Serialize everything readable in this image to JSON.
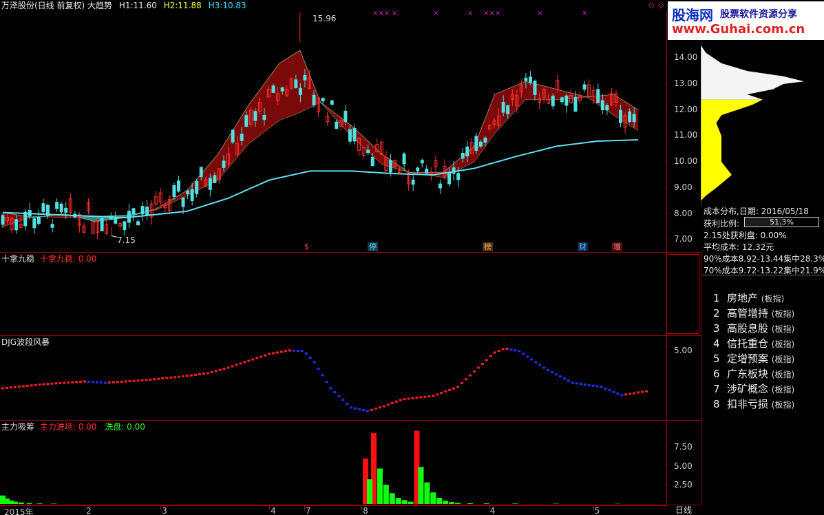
{
  "header": {
    "title": "万泽股份(日线 前复权) 大趋势",
    "h1_label": "H1:",
    "h1_value": "11.60",
    "h2_label": "H2:",
    "h2_value": "11.88",
    "h3_label": "H3:",
    "h3_value": "10.83",
    "diamond_left": "◇",
    "diamond_right": "◇"
  },
  "logo": {
    "brand": "股海网",
    "slogan": "股票软件资源分享",
    "url": "www.Guhai.com.cn"
  },
  "main_chart": {
    "price_high_label": "15.96",
    "price_low_label": "7.15",
    "y_ticks": [
      "14.00",
      "13.00",
      "12.00",
      "11.00",
      "10.00",
      "9.00",
      "8.00",
      "7.00"
    ],
    "event_labels": [
      {
        "text": "$",
        "color": "#ff4040"
      },
      {
        "text": "停",
        "color": "#60d0ff"
      },
      {
        "text": "榜",
        "color": "#ffb060"
      },
      {
        "text": "财",
        "color": "#60d0ff"
      },
      {
        "text": "增",
        "color": "#ff6060"
      }
    ],
    "markers": [
      "×××",
      "×",
      "×",
      "×",
      "×××",
      "×",
      "×"
    ]
  },
  "panel_2": {
    "name": "十拿九稳",
    "series_label": "十拿九稳:",
    "series_value": "0.00"
  },
  "panel_3": {
    "name": "DJG波段风暴",
    "y_ticks": [
      "5.00"
    ]
  },
  "panel_4": {
    "name": "主力吸筹",
    "series1_label": "主力进场:",
    "series1_value": "0.00",
    "series2_label": "洗盘:",
    "series2_value": "0.00",
    "y_ticks": [
      "7.50",
      "5.00",
      "2.50"
    ]
  },
  "x_axis": {
    "labels": [
      "2015年",
      "2",
      "3",
      "4",
      "7",
      "8",
      "4",
      "5"
    ],
    "period": "日线"
  },
  "cost_distribution": {
    "title": "成本分布,日期: 2016/05/18",
    "profit_ratio_label": "获利比例:",
    "profit_ratio_value": "51.3%",
    "profit_at_label": "2.15处获利盘: 0.00%",
    "avg_cost": "平均成本: 12.32元",
    "cost90": "90%成本8.92-13.44集中28.3%",
    "cost70": "70%成本9.72-13.22集中21.9%"
  },
  "sectors": [
    {
      "num": "1",
      "name": "房地产",
      "tag": "(板指)"
    },
    {
      "num": "2",
      "name": "高管增持",
      "tag": "(板指)"
    },
    {
      "num": "3",
      "name": "高股息股",
      "tag": "(板指)"
    },
    {
      "num": "4",
      "name": "信托重仓",
      "tag": "(板指)"
    },
    {
      "num": "5",
      "name": "定增预案",
      "tag": "(板指)"
    },
    {
      "num": "6",
      "name": "广东板块",
      "tag": "(板指)"
    },
    {
      "num": "7",
      "name": "涉矿概念",
      "tag": "(板指)"
    },
    {
      "num": "8",
      "name": "扣非亏损",
      "tag": "(板指)"
    }
  ],
  "chart_data": [
    {
      "type": "candlestick",
      "title": "万泽股份(日线 前复权) 大趋势",
      "ylim": [
        6.9,
        15.6
      ],
      "y_ticks": [
        14,
        13,
        12,
        11,
        10,
        9,
        8,
        7
      ],
      "x_labels": [
        "2015年",
        "2",
        "3",
        "4",
        "7",
        "8",
        "4",
        "5"
      ],
      "x_label_positions": [
        0,
        40,
        77,
        130,
        147,
        175,
        237,
        288
      ],
      "annotations": [
        {
          "text": "15.96",
          "x": 145,
          "y": 15.96
        },
        {
          "text": "7.15",
          "x": 53,
          "y": 7.15
        }
      ],
      "band_upper": [
        [
          0,
          8.05
        ],
        [
          15,
          7.85
        ],
        [
          30,
          8.0
        ],
        [
          45,
          7.7
        ],
        [
          60,
          7.85
        ],
        [
          75,
          8.2
        ],
        [
          90,
          8.9
        ],
        [
          105,
          10.3
        ],
        [
          120,
          12.2
        ],
        [
          135,
          13.8
        ],
        [
          145,
          14.3
        ],
        [
          155,
          12.3
        ],
        [
          170,
          11.4
        ],
        [
          185,
          10.3
        ],
        [
          198,
          9.6
        ],
        [
          215,
          9.6
        ],
        [
          230,
          10.6
        ],
        [
          240,
          12.6
        ],
        [
          255,
          13.1
        ],
        [
          270,
          12.8
        ],
        [
          285,
          12.5
        ],
        [
          298,
          12.6
        ],
        [
          310,
          12.0
        ]
      ],
      "band_lower": [
        [
          0,
          7.5
        ],
        [
          15,
          7.9
        ],
        [
          30,
          7.85
        ],
        [
          45,
          7.9
        ],
        [
          60,
          7.95
        ],
        [
          75,
          8.15
        ],
        [
          90,
          8.7
        ],
        [
          105,
          9.3
        ],
        [
          120,
          10.7
        ],
        [
          135,
          11.6
        ],
        [
          145,
          11.9
        ],
        [
          155,
          12.3
        ],
        [
          170,
          11.0
        ],
        [
          185,
          9.9
        ],
        [
          198,
          9.6
        ],
        [
          215,
          9.4
        ],
        [
          230,
          10.0
        ],
        [
          240,
          11.1
        ],
        [
          255,
          12.4
        ],
        [
          270,
          12.4
        ],
        [
          285,
          12.5
        ],
        [
          298,
          11.8
        ],
        [
          310,
          11.2
        ]
      ],
      "ma_line": [
        [
          0,
          8.05
        ],
        [
          30,
          7.95
        ],
        [
          60,
          7.85
        ],
        [
          90,
          8.1
        ],
        [
          110,
          8.6
        ],
        [
          130,
          9.3
        ],
        [
          150,
          9.65
        ],
        [
          170,
          9.65
        ],
        [
          190,
          9.55
        ],
        [
          210,
          9.5
        ],
        [
          230,
          9.75
        ],
        [
          250,
          10.2
        ],
        [
          270,
          10.6
        ],
        [
          290,
          10.8
        ],
        [
          310,
          10.85
        ]
      ],
      "volume_profile_y": [
        [
          14.5,
          0
        ],
        [
          14.2,
          0.05
        ],
        [
          13.8,
          0.2
        ],
        [
          13.5,
          0.45
        ],
        [
          13.3,
          0.8
        ],
        [
          13.1,
          1.0
        ],
        [
          13.0,
          0.8
        ],
        [
          12.8,
          0.7
        ],
        [
          12.6,
          0.45
        ],
        [
          12.4,
          0.6
        ],
        [
          12.2,
          0.5
        ],
        [
          12.0,
          0.35
        ],
        [
          11.8,
          0.2
        ],
        [
          11.5,
          0.15
        ],
        [
          11.0,
          0.2
        ],
        [
          10.5,
          0.2
        ],
        [
          10.0,
          0.2
        ],
        [
          9.5,
          0.3
        ],
        [
          9.0,
          0.15
        ],
        [
          8.7,
          0.05
        ],
        [
          8.5,
          0
        ]
      ]
    },
    {
      "type": "line",
      "title": "DJG波段风暴",
      "ylim": [
        0,
        5.6
      ],
      "y_ticks": [
        5
      ],
      "points": [
        [
          0,
          2.0
        ],
        [
          20,
          2.3
        ],
        [
          40,
          2.5
        ],
        [
          50,
          2.4
        ],
        [
          70,
          2.6
        ],
        [
          90,
          2.9
        ],
        [
          100,
          3.1
        ],
        [
          110,
          3.5
        ],
        [
          120,
          4.0
        ],
        [
          130,
          4.5
        ],
        [
          140,
          4.75
        ],
        [
          147,
          4.7
        ],
        [
          152,
          3.9
        ],
        [
          160,
          2.0
        ],
        [
          170,
          0.6
        ],
        [
          178,
          0.35
        ],
        [
          186,
          0.7
        ],
        [
          195,
          1.2
        ],
        [
          210,
          1.45
        ],
        [
          222,
          2.1
        ],
        [
          232,
          3.5
        ],
        [
          240,
          4.6
        ],
        [
          245,
          4.9
        ],
        [
          252,
          4.7
        ],
        [
          265,
          3.4
        ],
        [
          278,
          2.4
        ],
        [
          292,
          2.1
        ],
        [
          302,
          1.5
        ],
        [
          310,
          1.7
        ],
        [
          315,
          1.8
        ]
      ]
    },
    {
      "type": "bar",
      "title": "主力吸筹",
      "ylim": [
        0,
        10
      ],
      "y_ticks": [
        7.5,
        5,
        2.5
      ],
      "series": [
        {
          "name": "主力进场",
          "color": "#ff1010",
          "points": [
            [
              177,
              5.9
            ],
            [
              181,
              9.2
            ],
            [
              202,
              9.5
            ]
          ]
        },
        {
          "name": "洗盘",
          "color": "#10ff10",
          "points": [
            [
              0,
              1.1
            ],
            [
              2,
              0.7
            ],
            [
              4,
              0.45
            ],
            [
              6,
              0.3
            ],
            [
              9,
              0.2
            ],
            [
              13,
              0.12
            ],
            [
              18,
              0.07
            ],
            [
              25,
              0.05
            ],
            [
              179,
              3.2
            ],
            [
              184,
              4.6
            ],
            [
              187,
              2.5
            ],
            [
              190,
              1.4
            ],
            [
              193,
              0.8
            ],
            [
              196,
              0.5
            ],
            [
              199,
              0.3
            ],
            [
              204,
              4.8
            ],
            [
              207,
              2.8
            ],
            [
              210,
              1.5
            ],
            [
              213,
              0.8
            ],
            [
              216,
              0.4
            ],
            [
              219,
              0.25
            ],
            [
              222,
              0.15
            ],
            [
              228,
              0.1
            ],
            [
              236,
              0.08
            ],
            [
              250,
              0.06
            ],
            [
              270,
              0.04
            ],
            [
              300,
              0.03
            ]
          ]
        }
      ]
    }
  ]
}
